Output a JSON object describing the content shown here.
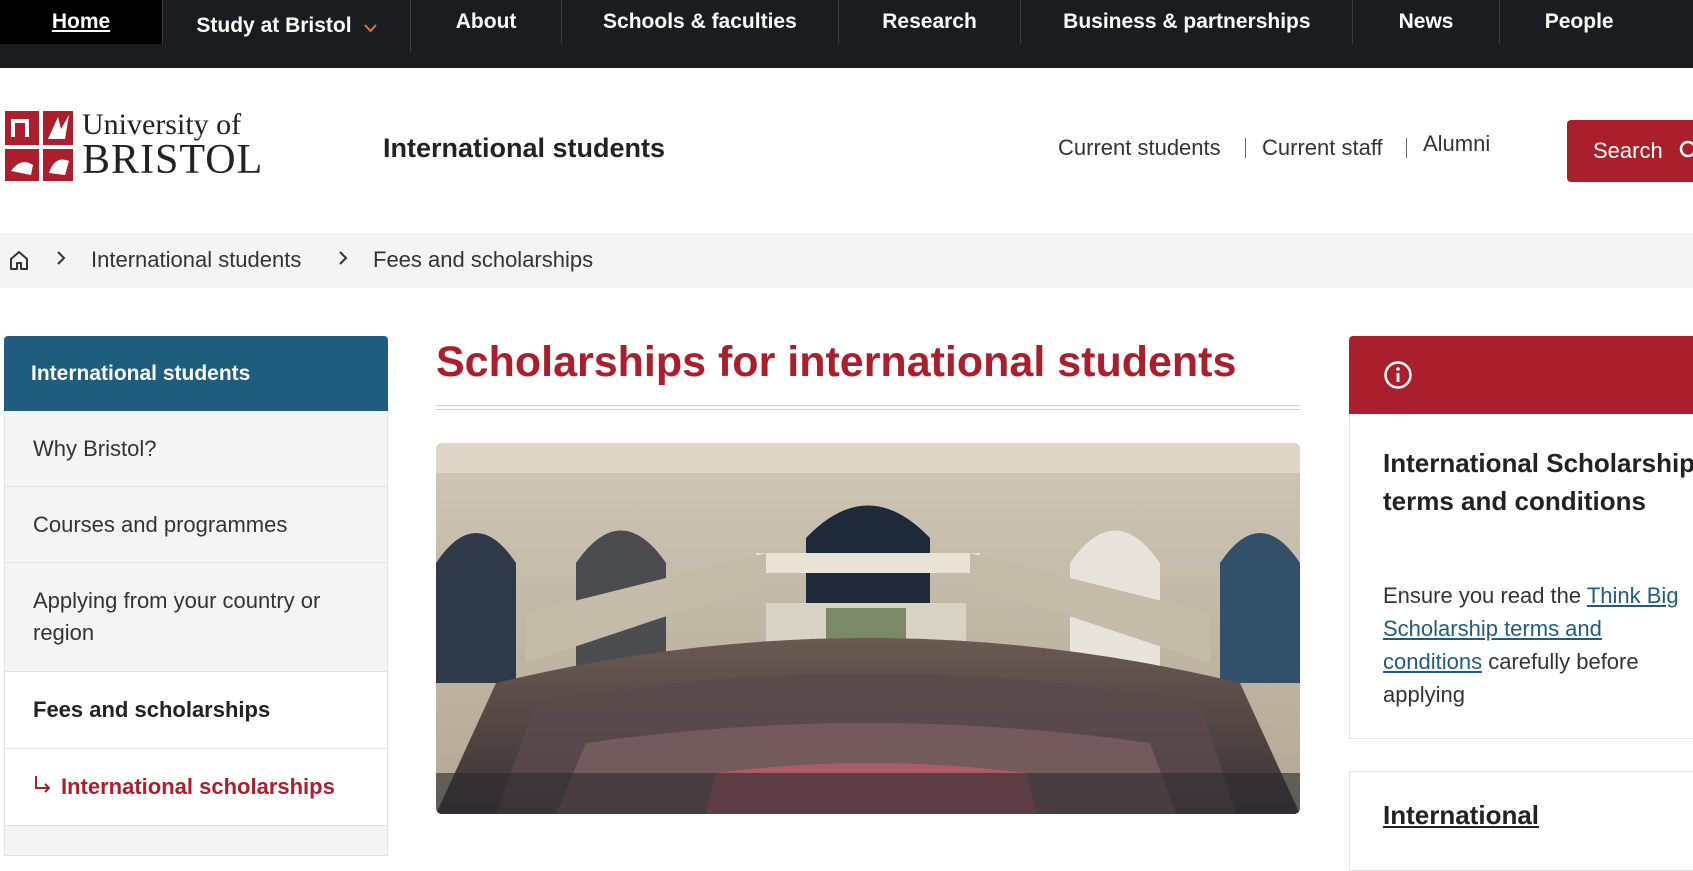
{
  "topnav": {
    "items": [
      {
        "label": "Home"
      },
      {
        "label": "Study at Bristol"
      },
      {
        "label": "About"
      },
      {
        "label": "Schools & faculties"
      },
      {
        "label": "Research"
      },
      {
        "label": "Business & partnerships"
      },
      {
        "label": "News"
      },
      {
        "label": "People"
      }
    ]
  },
  "header": {
    "logo_line1": "University of",
    "logo_line2": "BRISTOL",
    "site_title": "International students",
    "utility_links": [
      "Current students",
      "Current staff",
      "Alumni"
    ],
    "search_label": "Search"
  },
  "breadcrumb": {
    "items": [
      "International students",
      "Fees and scholarships"
    ]
  },
  "sidebar": {
    "heading": "International students",
    "items": [
      {
        "label": "Why Bristol?"
      },
      {
        "label": "Courses and programmes"
      },
      {
        "label": "Applying from your country or region"
      },
      {
        "label": "Fees and scholarships"
      },
      {
        "label": "International scholarships"
      }
    ]
  },
  "main": {
    "title": "Scholarships for international students"
  },
  "info_panel": {
    "title": "International Scholarship terms and conditions",
    "body_before": "Ensure you read the ",
    "link": "Think Big Scholarship terms and conditions",
    "body_after": " carefully before applying",
    "next_card_title": "International"
  },
  "colors": {
    "brand_red": "#ab1f2d",
    "sidebar_blue": "#1e5d7e",
    "nav_dark": "#1a1c1f"
  }
}
